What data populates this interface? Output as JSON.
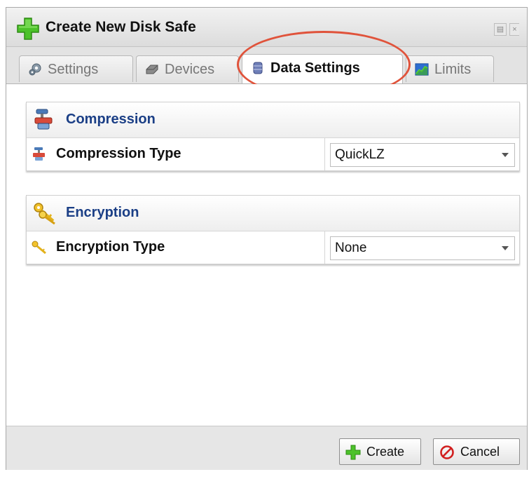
{
  "window": {
    "title": "Create New Disk Safe",
    "icons": {
      "title": "green-plus-icon",
      "restore": "restore-icon",
      "close": "close-icon"
    }
  },
  "tabs": [
    {
      "label": "Settings",
      "icon": "gear-icon",
      "active": false
    },
    {
      "label": "Devices",
      "icon": "disk-drive-icon",
      "active": false
    },
    {
      "label": "Data Settings",
      "icon": "database-icon",
      "active": true
    },
    {
      "label": "Limits",
      "icon": "chart-icon",
      "active": false
    }
  ],
  "compression": {
    "title": "Compression",
    "icon": "compression-clamp-icon",
    "type_label": "Compression Type",
    "type_value": "QuickLZ"
  },
  "encryption": {
    "title": "Encryption",
    "icon": "keys-icon",
    "type_label": "Encryption Type",
    "type_value": "None"
  },
  "footer": {
    "create_label": "Create",
    "cancel_label": "Cancel",
    "create_icon": "green-plus-icon",
    "cancel_icon": "cancel-icon"
  },
  "colors": {
    "section_title": "#1b3f86",
    "highlight": "#e0533b",
    "plus_green": "#3fb51b"
  }
}
